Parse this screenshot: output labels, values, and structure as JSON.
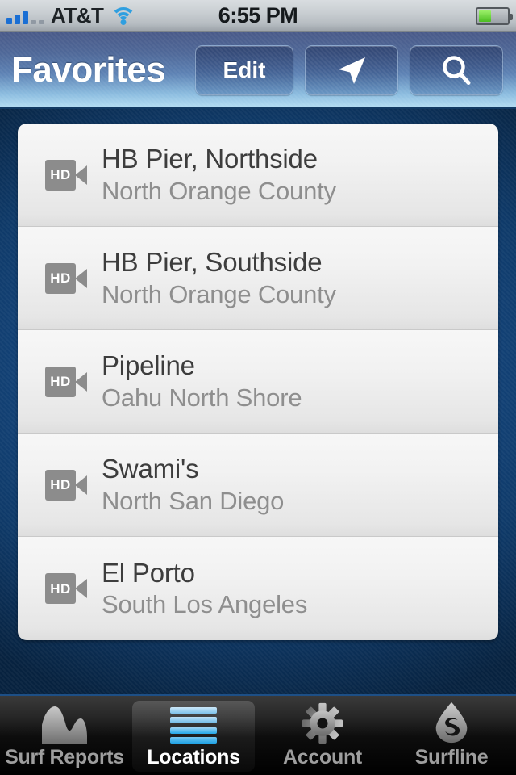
{
  "statusbar": {
    "carrier": "AT&T",
    "time": "6:55 PM",
    "wifi_icon": "wifi-icon",
    "signal_icon": "signal-bars-icon",
    "signal_bars_filled": 3,
    "signal_bars_total": 5,
    "battery_icon": "battery-icon",
    "battery_percent": 45
  },
  "navbar": {
    "title": "Favorites",
    "edit_label": "Edit",
    "locate_icon": "location-arrow-icon",
    "search_icon": "search-icon"
  },
  "list": {
    "rows": [
      {
        "badge": "HD",
        "title": "HB Pier, Northside",
        "subtitle": "North Orange County"
      },
      {
        "badge": "HD",
        "title": "HB Pier, Southside",
        "subtitle": "North Orange County"
      },
      {
        "badge": "HD",
        "title": "Pipeline",
        "subtitle": "Oahu North Shore"
      },
      {
        "badge": "HD",
        "title": "Swami's",
        "subtitle": "North San Diego"
      },
      {
        "badge": "HD",
        "title": "El Porto",
        "subtitle": "South Los Angeles"
      }
    ]
  },
  "tabbar": {
    "tabs": [
      {
        "label": "Surf Reports",
        "icon": "wave-chart-icon",
        "selected": false
      },
      {
        "label": "Locations",
        "icon": "list-lines-icon",
        "selected": true
      },
      {
        "label": "Account",
        "icon": "gear-icon",
        "selected": false
      },
      {
        "label": "Surfline",
        "icon": "water-drop-logo-icon",
        "selected": false
      }
    ]
  },
  "colors": {
    "nav_top": "#495a89",
    "nav_bottom": "#b3dcf2",
    "content_bg": "#0f3a69",
    "accent_blue": "#1fa2e4",
    "row_title": "#3d3d3d",
    "row_subtitle": "#8e8e8e",
    "badge_gray": "#8c8c8c"
  }
}
